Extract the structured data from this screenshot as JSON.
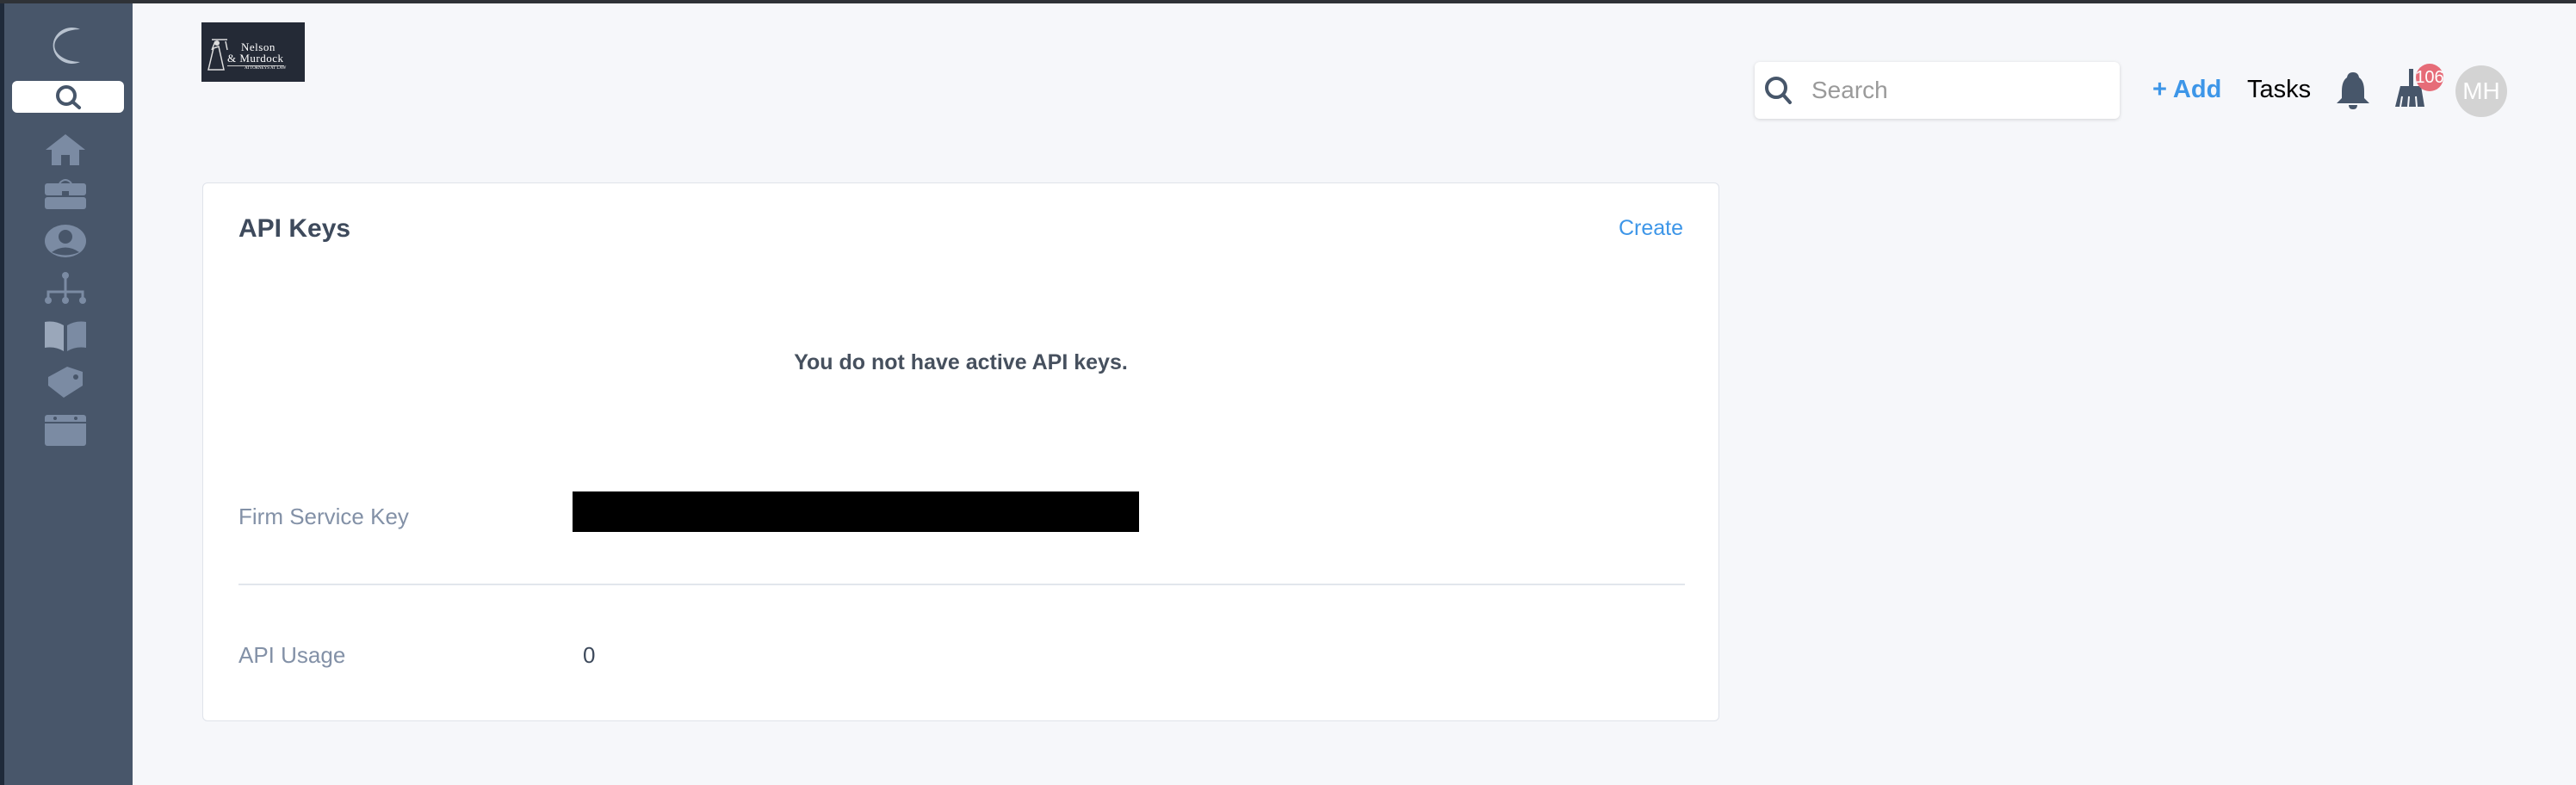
{
  "sidebar": {
    "items": [
      "search",
      "home",
      "matters",
      "contacts",
      "organization",
      "library",
      "billing",
      "calendar"
    ]
  },
  "firm": {
    "line1": "Nelson",
    "line2": "& Murdock",
    "line3": "Attorneys at Law"
  },
  "header": {
    "search_placeholder": "Search",
    "add_label": "+ Add",
    "tasks_label": "Tasks",
    "badge_count": "106",
    "avatar_initials": "MH"
  },
  "card": {
    "title": "API Keys",
    "create_label": "Create",
    "empty_message": "You do not have active API keys.",
    "firm_service_key_label": "Firm Service Key",
    "api_usage_label": "API Usage",
    "api_usage_value": "0"
  },
  "colors": {
    "sidebar": "#48566a",
    "accent": "#3d96e8",
    "badge": "#e66c78"
  }
}
